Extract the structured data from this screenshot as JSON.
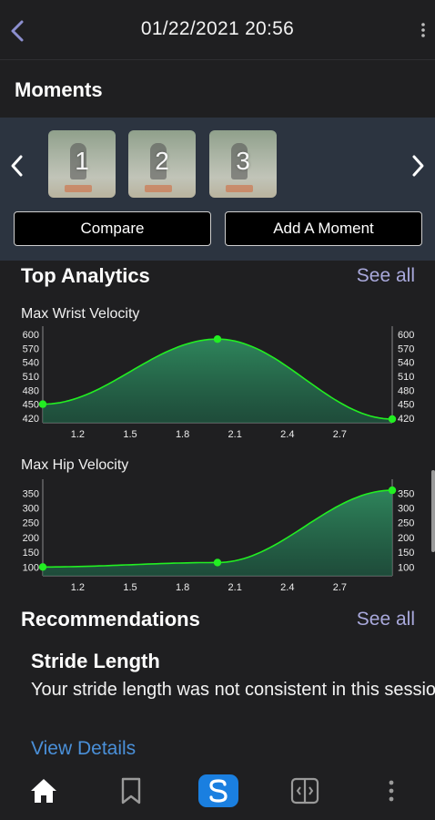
{
  "header": {
    "title": "01/22/2021 20:56",
    "back_icon": "chevron-left-icon",
    "menu_icon": "more-vertical-icon"
  },
  "moments": {
    "title": "Moments",
    "thumbnails": [
      {
        "label": "1"
      },
      {
        "label": "2"
      },
      {
        "label": "3"
      }
    ],
    "compare_label": "Compare",
    "add_label": "Add A Moment"
  },
  "top_analytics": {
    "title": "Top Analytics",
    "see_all": "See all"
  },
  "charts": {
    "wrist_title": "Max Wrist Velocity",
    "hip_title": "Max Hip Velocity"
  },
  "chart_data": [
    {
      "type": "area",
      "title": "Max Wrist Velocity",
      "x": [
        1.0,
        2.0,
        3.0
      ],
      "values": [
        450,
        590,
        418
      ],
      "x_ticks": [
        "1.2",
        "1.5",
        "1.8",
        "2.1",
        "2.4",
        "2.7"
      ],
      "y_ticks": [
        "600",
        "570",
        "540",
        "510",
        "480",
        "450",
        "420"
      ],
      "xlim": [
        1.0,
        3.0
      ],
      "ylim": [
        410,
        610
      ],
      "grid": false,
      "color": "#22ee22"
    },
    {
      "type": "area",
      "title": "Max Hip Velocity",
      "x": [
        1.0,
        2.0,
        3.0
      ],
      "values": [
        100,
        115,
        360
      ],
      "x_ticks": [
        "1.2",
        "1.5",
        "1.8",
        "2.1",
        "2.4",
        "2.7"
      ],
      "y_ticks": [
        "350",
        "300",
        "250",
        "200",
        "150",
        "100"
      ],
      "xlim": [
        1.0,
        3.0
      ],
      "ylim": [
        70,
        385
      ],
      "grid": false,
      "color": "#22ee22"
    }
  ],
  "recommendations": {
    "title": "Recommendations",
    "see_all": "See all",
    "item_title": "Stride Length",
    "item_body": "Your stride length was not consistent in this session.",
    "link": "View Details"
  },
  "bottom_nav": {
    "items": [
      "home-icon",
      "bookmark-icon",
      "s-logo-icon",
      "compare-icon",
      "more-vertical-icon"
    ]
  },
  "colors": {
    "background": "#1f1f21",
    "panel": "#2c3440",
    "accent_link": "#4a90d9",
    "see_all": "#a9a9dc",
    "chart_line": "#22ee22",
    "brand": "#1a7fe0"
  }
}
